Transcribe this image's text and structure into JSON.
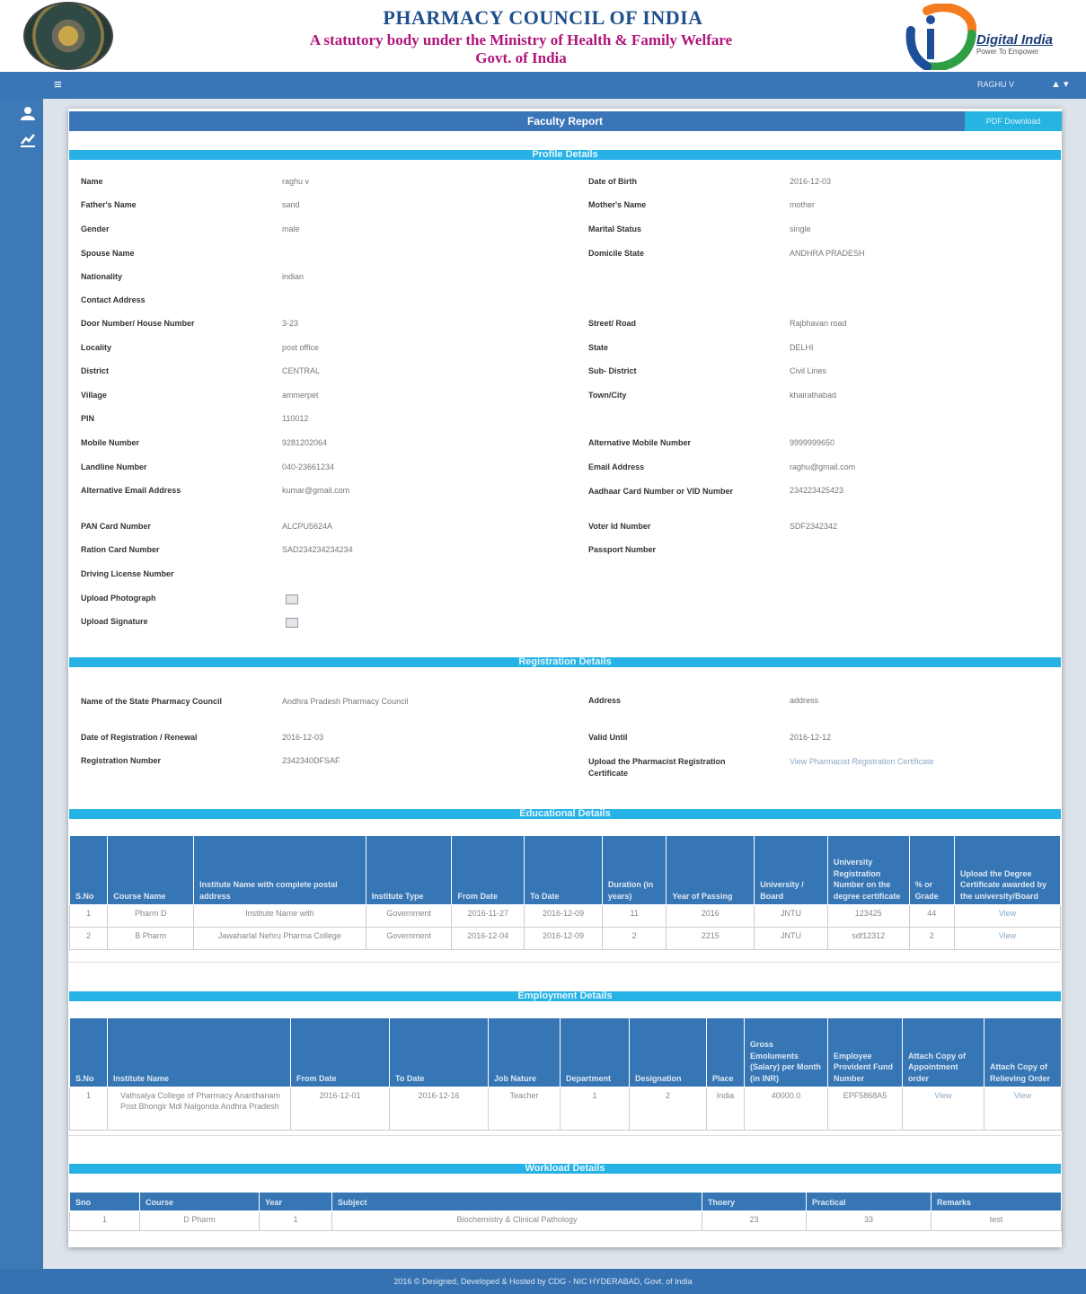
{
  "header": {
    "title": "PHARMACY COUNCIL OF INDIA",
    "subtitle": "A statutory body under the Ministry of Health & Family Welfare",
    "govt": "Govt. of India",
    "digital_india": "Digital India",
    "digital_india_tagline": "Power To Empower"
  },
  "navbar": {
    "menu_icon": "≡",
    "user_name": "RAGHU V",
    "user_icon": "▲ ▾"
  },
  "sidebar": {
    "items": [
      {
        "icon": "person-icon"
      },
      {
        "icon": "chart-icon"
      }
    ]
  },
  "report": {
    "title": "Faculty Report",
    "pdf_button": "PDF Download"
  },
  "sections": {
    "profile": "Profile Details",
    "registration": "Registration Details",
    "educational": "Educational Details",
    "employment": "Employment Details",
    "workload": "Workload Details"
  },
  "profile": {
    "name_label": "Name",
    "name": "raghu v",
    "dob_label": "Date of Birth",
    "dob": "2016-12-03",
    "father_label": "Father's Name",
    "father": "sand",
    "mother_label": "Mother's Name",
    "mother": "mother",
    "gender_label": "Gender",
    "gender": "male",
    "marital_label": "Marital Status",
    "marital": "single",
    "spouse_label": "Spouse Name",
    "domicile_label": "Domicile State",
    "domicile": "ANDHRA PRADESH",
    "nationality_label": "Nationality",
    "nationality": "indian",
    "contact_label": "Contact Address",
    "door_label": "Door Number/ House Number",
    "door": "3-23",
    "street_label": "Street/ Road",
    "street": "Rajbhavan road",
    "locality_label": "Locality",
    "locality": "post office",
    "state_label": "State",
    "state": "DELHI",
    "district_label": "District",
    "district": "CENTRAL",
    "subdistrict_label": "Sub- District",
    "subdistrict": "Civil Lines",
    "village_label": "Village",
    "village": "ammerpet",
    "town_label": "Town/City",
    "town": "khairathabad",
    "pin_label": "PIN",
    "pin": "110012",
    "mobile_label": "Mobile Number",
    "mobile": "9281202064",
    "alt_mobile_label": "Alternative Mobile Number",
    "alt_mobile": "9999999650",
    "landline_label": "Landline Number",
    "landline": "040-23661234",
    "email_label": "Email Address",
    "email": "raghu@gmail.com",
    "alt_email_label": "Alternative Email Address",
    "alt_email": "kumar@gmail.com",
    "aadhaar_label": "Aadhaar Card Number or VID Number",
    "aadhaar": "234223425423",
    "pan_label": "PAN Card Number",
    "pan": "ALCPU5624A",
    "voter_label": "Voter Id Number",
    "voter": "SDF2342342",
    "ration_label": "Ration Card Number",
    "ration": "SAD234234234234",
    "passport_label": "Passport Number",
    "driving_label": "Driving License Number",
    "photo_label": "Upload Photograph",
    "signature_label": "Upload Signature"
  },
  "registration": {
    "council_label": "Name of the State Pharmacy Council",
    "council": "Andhra Pradesh Pharmacy Council",
    "address_label": "Address",
    "address": "address",
    "date_label": "Date of Registration / Renewal",
    "date": "2016-12-03",
    "valid_label": "Valid Until",
    "valid": "2016-12-12",
    "number_label": "Registration Number",
    "number": "2342340DFSAF",
    "cert_label": "Upload the Pharmacist Registration Certificate",
    "cert_link": "View Pharmacist Registration Certificate"
  },
  "educational": {
    "headers": [
      "S.No",
      "Course Name",
      "Institute Name with complete postal address",
      "Institute Type",
      "From Date",
      "To Date",
      "Duration (in years)",
      "Year of Passing",
      "University / Board",
      "University Registration Number on the degree certificate",
      "% or Grade",
      "Upload the Degree Certificate awarded by the university/Board"
    ],
    "rows": [
      [
        "1",
        "Pharm D",
        "Institute Name with",
        "Government",
        "2016-11-27",
        "2016-12-09",
        "11",
        "2016",
        "JNTU",
        "123425",
        "44",
        "View"
      ],
      [
        "2",
        "B Pharm",
        "Jawaharlal Nehru Pharma College",
        "Government",
        "2016-12-04",
        "2016-12-09",
        "2",
        "2215",
        "JNTU",
        "sdf12312",
        "2",
        "View"
      ]
    ]
  },
  "employment": {
    "headers": [
      "S.No",
      "Institute Name",
      "From Date",
      "To Date",
      "Job Nature",
      "Department",
      "Designation",
      "Place",
      "Gross Emoluments (Salary) per Month (in INR)",
      "Employee Provident Fund Number",
      "Attach Copy of Appointment order",
      "Attach Copy of Relieving Order"
    ],
    "rows": [
      [
        "1",
        "Vathsalya College of Pharmacy Ananthanam Post Bhongir Mdl Nalgonda Andhra Pradesh",
        "2016-12-01",
        "2016-12-16",
        "Teacher",
        "1",
        "2",
        "India",
        "40000.0",
        "EPF5868A5",
        "View",
        "View"
      ]
    ]
  },
  "workload": {
    "headers": [
      "Sno",
      "Course",
      "Year",
      "Subject",
      "Thoery",
      "Practical",
      "Remarks"
    ],
    "rows": [
      [
        "1",
        "D Pharm",
        "1",
        "Biochemistry & Clinical Pathology",
        "23",
        "33",
        "test"
      ]
    ]
  },
  "footer": "2016 © Designed, Developed & Hosted by CDG - NIC HYDERABAD, Govt. of India",
  "colors": {
    "primary": "#3a75b8",
    "section": "#27b2e6",
    "title": "#1f4f8c",
    "subtitle": "#b0157a"
  }
}
